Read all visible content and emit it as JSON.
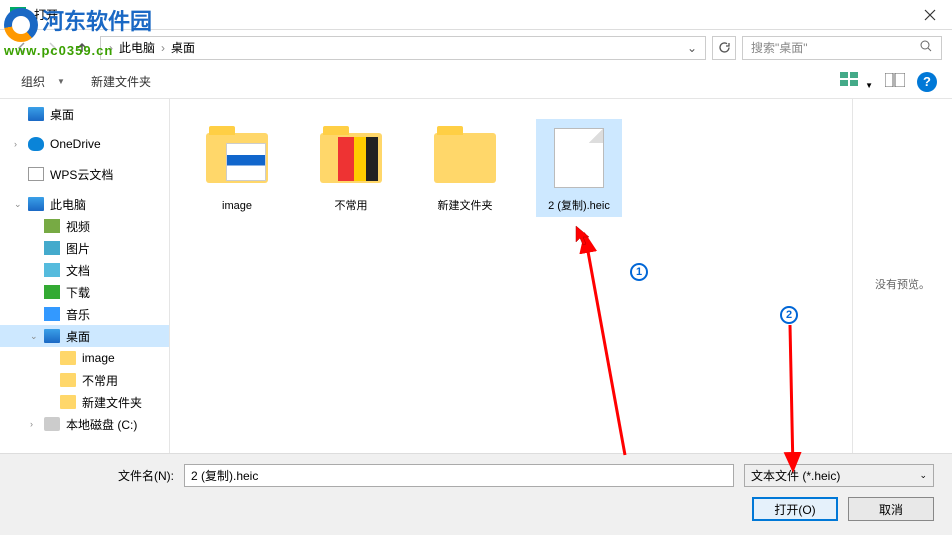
{
  "window": {
    "title": "打开"
  },
  "breadcrumb": {
    "item1": "此电脑",
    "item2": "桌面"
  },
  "search": {
    "placeholder": "搜索\"桌面\""
  },
  "toolbar": {
    "organize": "组织",
    "newfolder": "新建文件夹"
  },
  "sidebar": {
    "items": [
      {
        "label": "桌面",
        "icon": "ico-desktop"
      },
      {
        "label": "OneDrive",
        "icon": "ico-onedrive"
      },
      {
        "label": "WPS云文档",
        "icon": "ico-doc"
      },
      {
        "label": "此电脑",
        "icon": "ico-pc"
      },
      {
        "label": "视频",
        "icon": "ico-video"
      },
      {
        "label": "图片",
        "icon": "ico-pic"
      },
      {
        "label": "文档",
        "icon": "ico-txt"
      },
      {
        "label": "下载",
        "icon": "ico-dl"
      },
      {
        "label": "音乐",
        "icon": "ico-music"
      },
      {
        "label": "桌面",
        "icon": "ico-desktop"
      },
      {
        "label": "image",
        "icon": "ico-folder"
      },
      {
        "label": "不常用",
        "icon": "ico-folder"
      },
      {
        "label": "新建文件夹",
        "icon": "ico-folder"
      },
      {
        "label": "本地磁盘 (C:)",
        "icon": "ico-disk"
      }
    ]
  },
  "files": [
    {
      "label": "image",
      "type": "folder-img"
    },
    {
      "label": "不常用",
      "type": "folder-img2"
    },
    {
      "label": "新建文件夹",
      "type": "folder"
    },
    {
      "label": "2 (复制).heic",
      "type": "file",
      "selected": true
    }
  ],
  "preview": {
    "text": "没有预览。"
  },
  "footer": {
    "filename_label": "文件名(N):",
    "filename_value": "2 (复制).heic",
    "filetype": "文本文件 (*.heic)",
    "open": "打开(O)",
    "cancel": "取消"
  },
  "markers": {
    "m1": "1",
    "m2": "2"
  },
  "watermark": {
    "name": "河东软件园",
    "url": "www.pc0359.cn"
  }
}
